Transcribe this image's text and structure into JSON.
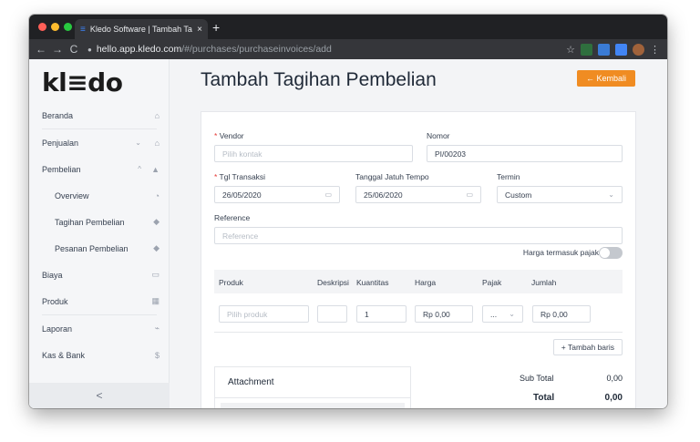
{
  "browser": {
    "tab_title": "Kledo Software | Tambah Tagih",
    "tab_close": "×",
    "new_tab": "+",
    "url_host": "hello.app.kledo.com",
    "url_path": "/#/purchases/purchaseinvoices/add",
    "nav_back": "←",
    "nav_forward": "→",
    "nav_reload": "C",
    "lock": "🔒",
    "star": "☆",
    "menu": "⋮"
  },
  "sidebar": {
    "logo": "kl≡do",
    "items": [
      {
        "label": "Beranda",
        "icon": "⌂"
      },
      {
        "label": "Penjualan",
        "icon": "⌂"
      },
      {
        "label": "Pembelian",
        "icon": "▲"
      },
      {
        "label": "Overview",
        "icon": "◔"
      },
      {
        "label": "Tagihan Pembelian",
        "icon": "◆"
      },
      {
        "label": "Pesanan Pembelian",
        "icon": "◆"
      },
      {
        "label": "Biaya",
        "icon": "▭"
      },
      {
        "label": "Produk",
        "icon": "▦"
      },
      {
        "label": "Laporan",
        "icon": "⌁"
      },
      {
        "label": "Kas & Bank",
        "icon": "$"
      }
    ],
    "chevron_down": "⌄",
    "chevron_up": "^",
    "collapse": "<"
  },
  "page": {
    "title": "Tambah Tagihan Pembelian",
    "back_button": "← Kembali"
  },
  "form": {
    "required_mark": "*",
    "vendor_label": "Vendor",
    "vendor_placeholder": "Pilih kontak",
    "nomor_label": "Nomor",
    "nomor_value": "PI/00203",
    "tgl_transaksi_label": "Tgl Transaksi",
    "tgl_transaksi_value": "26/05/2020",
    "tgl_jatuh_tempo_label": "Tanggal Jatuh Tempo",
    "tgl_jatuh_tempo_value": "25/06/2020",
    "termin_label": "Termin",
    "termin_value": "Custom",
    "reference_label": "Reference",
    "reference_placeholder": "Reference",
    "harga_pajak_label": "Harga termasuk pajak",
    "calendar_icon": "▭",
    "dropdown_icon": "⌄"
  },
  "table": {
    "headers": [
      "Produk",
      "Deskripsi",
      "Kuantitas",
      "Harga",
      "Pajak",
      "Jumlah"
    ],
    "row": {
      "produk_placeholder": "Pilih produk",
      "deskripsi": "",
      "kuantitas": "1",
      "harga": "Rp 0,00",
      "pajak": "...",
      "jumlah": "Rp 0,00"
    },
    "add_row": "+ Tambah baris"
  },
  "attachment": {
    "title": "Attachment"
  },
  "summary": {
    "subtotal_label": "Sub Total",
    "subtotal_value": "0,00",
    "total_label": "Total",
    "total_value": "0,00"
  },
  "colors": {
    "accent": "#f08c22",
    "required": "#e53935"
  }
}
